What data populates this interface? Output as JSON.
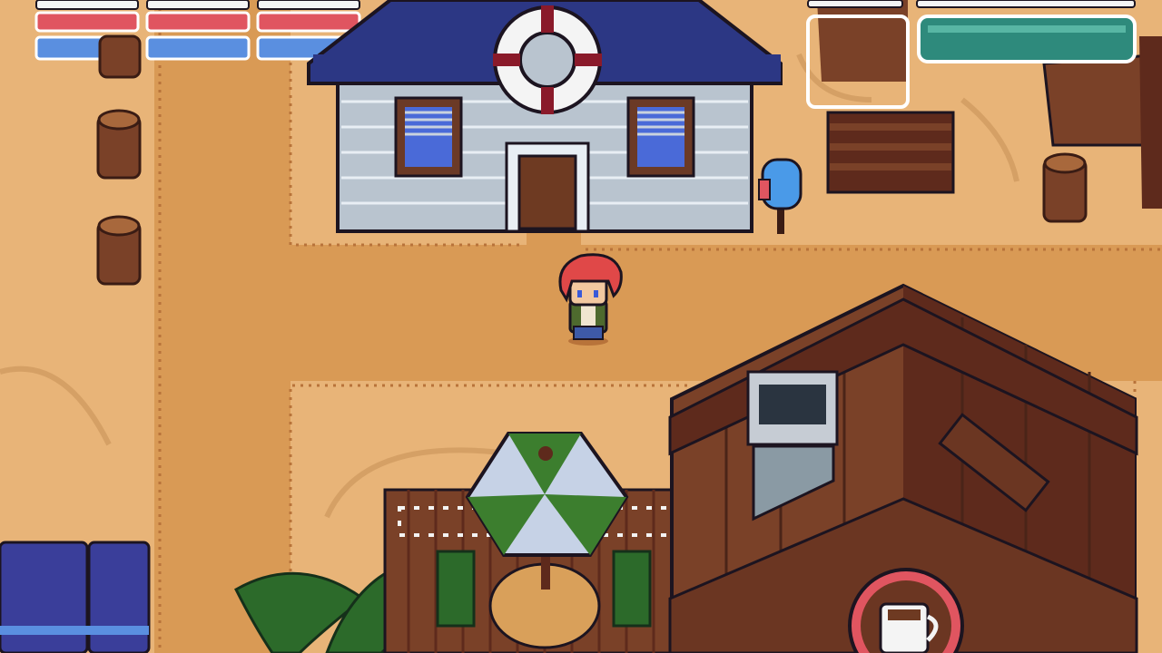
{
  "scene": "beach-town",
  "colors": {
    "sand": "#e8b478",
    "path": "#d99a55",
    "hud_red": "#e05560",
    "hud_blue": "#5a8fe0",
    "hud_teal": "#2e8a7c",
    "house_wall": "#b9c4cf",
    "roof_navy": "#2c3784",
    "cafe_wood": "#7a4128",
    "umbrella_green": "#3c7e2e",
    "hair_red": "#e04848"
  },
  "hud": {
    "party": [
      {
        "slot": 1,
        "hp": 1.0,
        "mp": 1.0
      },
      {
        "slot": 2,
        "hp": 1.0,
        "mp": 1.0
      },
      {
        "slot": 3,
        "hp": 1.0,
        "mp": 1.0
      }
    ],
    "portrait_frame": "empty",
    "stamina": 1.0
  },
  "icons": {
    "player": "player-character-icon",
    "mailbox": "mailbox-icon",
    "lifebuoy": "lifebuoy-icon",
    "coffee": "coffee-cup-icon"
  }
}
